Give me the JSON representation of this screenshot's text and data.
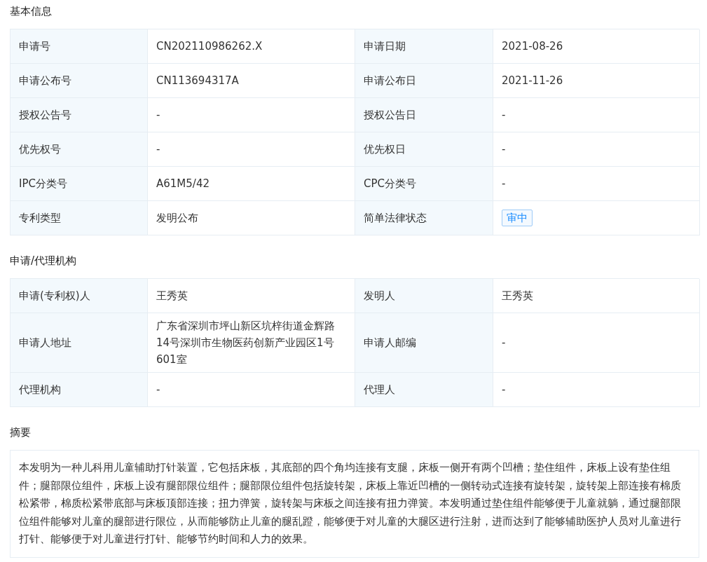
{
  "sections": [
    {
      "title": "基本信息",
      "rows": [
        [
          {
            "label": "申请号",
            "value": "CN202110986262.X",
            "kind": "text"
          },
          {
            "label": "申请日期",
            "value": "2021-08-26",
            "kind": "text"
          }
        ],
        [
          {
            "label": "申请公布号",
            "value": "CN113694317A",
            "kind": "text"
          },
          {
            "label": "申请公布日",
            "value": "2021-11-26",
            "kind": "text"
          }
        ],
        [
          {
            "label": "授权公告号",
            "value": "-",
            "kind": "text"
          },
          {
            "label": "授权公告日",
            "value": "-",
            "kind": "text"
          }
        ],
        [
          {
            "label": "优先权号",
            "value": "-",
            "kind": "text"
          },
          {
            "label": "优先权日",
            "value": "-",
            "kind": "text"
          }
        ],
        [
          {
            "label": "IPC分类号",
            "value": "A61M5/42",
            "kind": "text"
          },
          {
            "label": "CPC分类号",
            "value": "-",
            "kind": "text"
          }
        ],
        [
          {
            "label": "专利类型",
            "value": "发明公布",
            "kind": "text"
          },
          {
            "label": "简单法律状态",
            "value": "审中",
            "kind": "tag"
          }
        ]
      ]
    },
    {
      "title": "申请/代理机构",
      "rows": [
        [
          {
            "label": "申请(专利权)人",
            "value": "王秀英",
            "kind": "text"
          },
          {
            "label": "发明人",
            "value": "王秀英",
            "kind": "text"
          }
        ],
        [
          {
            "label": "申请人地址",
            "value": "广东省深圳市坪山新区坑梓街道金辉路14号深圳市生物医药创新产业园区1号601室",
            "kind": "text"
          },
          {
            "label": "申请人邮编",
            "value": "-",
            "kind": "text"
          }
        ],
        [
          {
            "label": "代理机构",
            "value": "-",
            "kind": "text"
          },
          {
            "label": "代理人",
            "value": "-",
            "kind": "text"
          }
        ]
      ]
    }
  ],
  "abstract": {
    "title": "摘要",
    "text": "本发明为一种儿科用儿童辅助打针装置，它包括床板，其底部的四个角均连接有支腿，床板一侧开有两个凹槽；垫住组件，床板上设有垫住组件；腿部限位组件，床板上设有腿部限位组件；腿部限位组件包括旋转架，床板上靠近凹槽的一侧转动式连接有旋转架，旋转架上部连接有棉质松紧带，棉质松紧带底部与床板顶部连接；扭力弹簧，旋转架与床板之间连接有扭力弹簧。本发明通过垫住组件能够便于儿童就躺，通过腿部限位组件能够对儿童的腿部进行限位，从而能够防止儿童的腿乱蹬，能够便于对儿童的大腿区进行注射，进而达到了能够辅助医护人员对儿童进行打针、能够便于对儿童进行打针、能够节约时间和人力的效果。"
  }
}
